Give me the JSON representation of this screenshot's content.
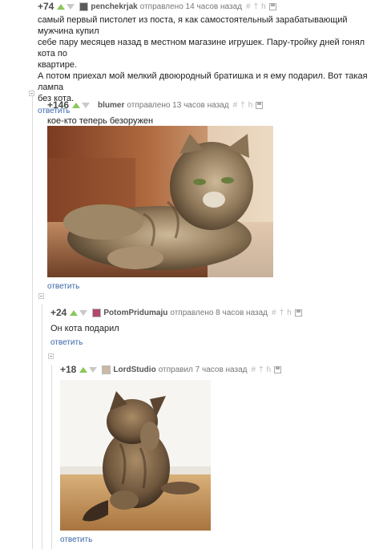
{
  "comments": [
    {
      "rating": "+74",
      "author": "penchekrjak",
      "time": "отправлено 14 часов назад",
      "text_lines": [
        "самый первый пистолет из поста, я как самостоятельный зарабатывающий мужчина купил",
        "себе пару месяцев назад в местном магазине игрушек. Пару-тройку дней гонял кота по",
        "квартире.",
        "А потом приехал мой мелкий двоюродный братишка и я ему подарил. Вот такая лампа",
        "без кота."
      ],
      "reply": "ответить"
    },
    {
      "rating": "+146",
      "author": "blumer",
      "time": "отправлено 13 часов назад",
      "text": "кое-кто теперь безоружен",
      "reply": "ответить"
    },
    {
      "rating": "+24",
      "author": "PotomPridumaju",
      "time": "отправлено 8 часов назад",
      "text": "Он кота подарил",
      "reply": "ответить"
    },
    {
      "rating": "+18",
      "author": "LordStudio",
      "time": "отправил 7 часов назад",
      "reply": "ответить"
    }
  ],
  "tools": {
    "hash": "#",
    "dagger": "†",
    "h": "h"
  },
  "colors": {
    "upvote": "#8ac858",
    "downvote": "#c9c9c9",
    "reply_link": "#3a66a8"
  }
}
